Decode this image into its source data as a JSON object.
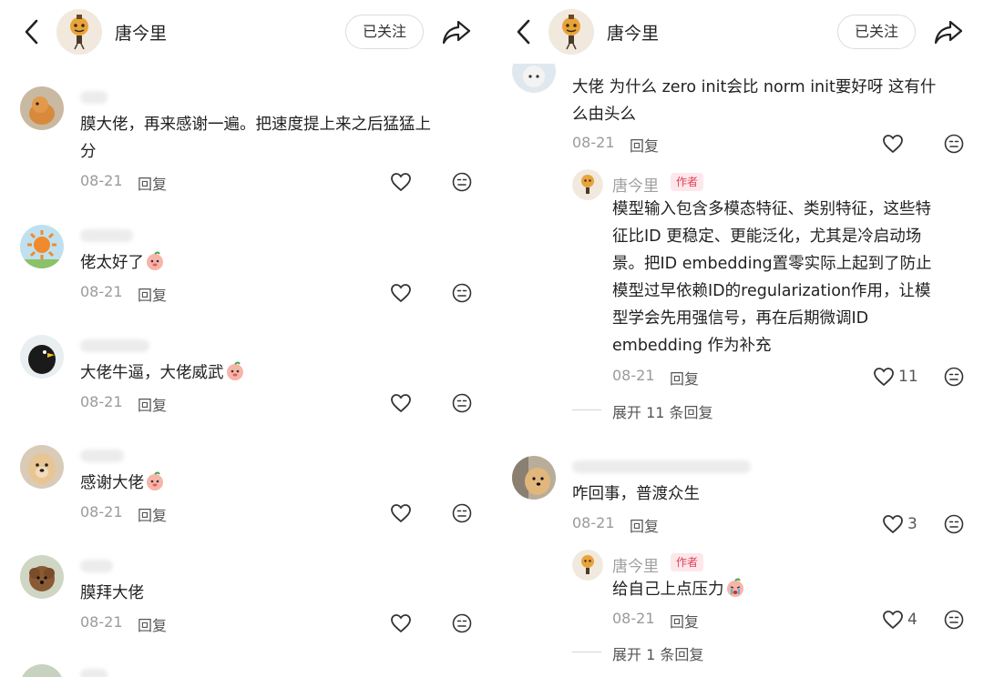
{
  "header": {
    "name": "唐今里",
    "follow_label": "已关注"
  },
  "colors": {
    "accent": "#e1405b",
    "muted": "#9a9a9a",
    "text": "#222222"
  },
  "left_comments": [
    {
      "text_line1": "膜大佬，再来感谢一遍。把速度提上来之后猛猛上",
      "text_line2": "分",
      "date": "08-21",
      "reply": "回复"
    },
    {
      "text": "佬太好了",
      "date": "08-21",
      "reply": "回复"
    },
    {
      "text": "大佬牛逼，大佬威武",
      "date": "08-21",
      "reply": "回复"
    },
    {
      "text": "感谢大佬",
      "date": "08-21",
      "reply": "回复"
    },
    {
      "text": "膜拜大佬",
      "date": "08-21",
      "reply": "回复"
    }
  ],
  "right": {
    "top_comment": {
      "line1": "大佬 为什么 zero init会比 norm init要好呀 这有什",
      "line2": "么由头么",
      "date": "08-21",
      "reply": "回复"
    },
    "author_reply1": {
      "name": "唐今里",
      "tag": "作者",
      "lines": [
        "模型输入包含多模态特征、类别特征，这些特",
        "征比ID 更稳定、更能泛化，尤其是冷启动场",
        "景。把ID embedding置零实际上起到了防止",
        "模型过早依赖ID的regularization作用，让模",
        "型学会先用强信号，再在后期微调ID",
        "embedding 作为补充"
      ],
      "date": "08-21",
      "reply": "回复",
      "likes": "11"
    },
    "expand1": "展开 11 条回复",
    "comment2": {
      "text": "咋回事，普渡众生",
      "date": "08-21",
      "reply": "回复",
      "likes": "3"
    },
    "author_reply2": {
      "name": "唐今里",
      "tag": "作者",
      "text": "给自己上点压力",
      "date": "08-21",
      "reply": "回复",
      "likes": "4"
    },
    "expand2": "展开 1 条回复"
  }
}
